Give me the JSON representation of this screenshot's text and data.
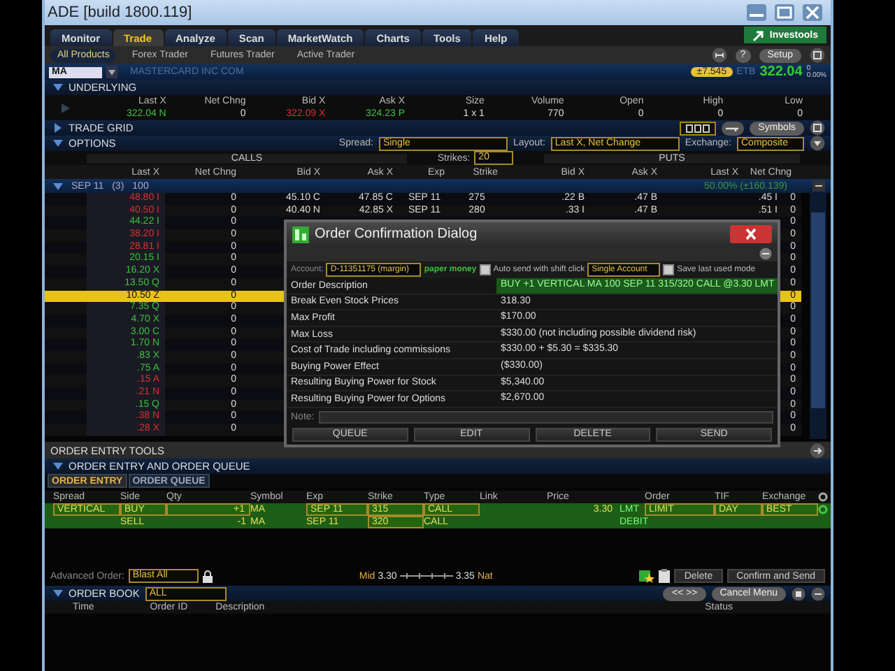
{
  "window": {
    "title": "ADE [build 1800.119]"
  },
  "main_tabs": [
    {
      "label": "Monitor",
      "selected": false
    },
    {
      "label": "Trade",
      "selected": true
    },
    {
      "label": "Analyze",
      "selected": false
    },
    {
      "label": "Scan",
      "selected": false
    },
    {
      "label": "MarketWatch",
      "selected": false
    },
    {
      "label": "Charts",
      "selected": false
    },
    {
      "label": "Tools",
      "selected": false
    },
    {
      "label": "Help",
      "selected": false
    }
  ],
  "investools_button": "Investools",
  "sub_tabs": [
    {
      "label": "All Products",
      "selected": true
    },
    {
      "label": "Forex Trader",
      "selected": false
    },
    {
      "label": "Futures Trader",
      "selected": false
    },
    {
      "label": "Active Trader",
      "selected": false
    }
  ],
  "help_button": "?",
  "setup_button": "Setup",
  "symbol_bar": {
    "symbol": "MA",
    "company": "MASTERCARD INC COM",
    "badge": "±7.545",
    "etb": "ETB",
    "last": "322.04",
    "change": "0",
    "percent": "0.00%"
  },
  "underlying": {
    "title": "UNDERLYING",
    "expanded": true,
    "columns": [
      "Last X",
      "Net Chng",
      "Bid X",
      "Ask X",
      "Size",
      "Volume",
      "Open",
      "High",
      "Low"
    ],
    "values": [
      {
        "text": "322.04 N",
        "color": "#3bc43b"
      },
      {
        "text": "0",
        "color": "#dddddd"
      },
      {
        "text": "322.09 X",
        "color": "#d83232"
      },
      {
        "text": "324.23 P",
        "color": "#3bc43b"
      },
      {
        "text": "1 x 1",
        "color": "#dddddd"
      },
      {
        "text": "770",
        "color": "#dddddd"
      },
      {
        "text": "0",
        "color": "#dddddd"
      },
      {
        "text": "0",
        "color": "#dddddd"
      },
      {
        "text": "0",
        "color": "#dddddd"
      }
    ]
  },
  "trade_grid": {
    "title": "TRADE GRID",
    "expanded": false,
    "symbols_button": "Symbols"
  },
  "options": {
    "title": "OPTIONS",
    "expanded": true,
    "spread_label": "Spread:",
    "spread": "Single",
    "layout_label": "Layout:",
    "layout": "Last X, Net Change",
    "exchange_label": "Exchange:",
    "exchange": "Composite",
    "calls_label": "CALLS",
    "puts_label": "PUTS",
    "strikes_label": "Strikes:",
    "strikes": "20",
    "columns": [
      "Last X",
      "Net Chng",
      "Bid X",
      "Ask X",
      "Exp",
      "Strike",
      "Bid X",
      "Ask X",
      "Last X",
      "Net Chng"
    ],
    "group": {
      "expiry": "SEP 11",
      "count": "(3)",
      "multiplier": "100",
      "expanded": true,
      "implied": "50.00% (±160.139)"
    },
    "rows": [
      {
        "selected": false,
        "color": "#d83232",
        "last": "48.80 I",
        "net": "0",
        "bid": "45.10 C",
        "ask": "47.85 C",
        "exp": "SEP 11",
        "strike": "275",
        "put_bid": ".22 B",
        "put_ask": ".47 B",
        "put_last": ".45 I",
        "put_net": "0"
      },
      {
        "selected": false,
        "color": "#d83232",
        "last": "40.50 I",
        "net": "0",
        "bid": "40.40 N",
        "ask": "42.85 X",
        "exp": "SEP 11",
        "strike": "280",
        "put_bid": ".33 I",
        "put_ask": ".47 B",
        "put_last": ".51 I",
        "put_net": "0"
      },
      {
        "selected": false,
        "color": "#3bc43b",
        "last": "44.22 I",
        "net": "0",
        "put_net": "0"
      },
      {
        "selected": false,
        "color": "#d83232",
        "last": "38.20 I",
        "net": "0",
        "put_net": "0"
      },
      {
        "selected": false,
        "color": "#d83232",
        "last": "28.81 I",
        "net": "0",
        "put_net": "0"
      },
      {
        "selected": false,
        "color": "#3bc43b",
        "last": "20.15 I",
        "net": "0",
        "put_net": "0"
      },
      {
        "selected": false,
        "color": "#3bc43b",
        "last": "16.20 X",
        "net": "0",
        "put_net": "0"
      },
      {
        "selected": false,
        "color": "#3bc43b",
        "last": "13.50 Q",
        "net": "0",
        "put_net": "0"
      },
      {
        "selected": true,
        "last": "10.50 Z",
        "net": "0",
        "put_net": "0"
      },
      {
        "selected": false,
        "color": "#3bc43b",
        "last": "7.35 Q",
        "net": "0",
        "put_net": "0"
      },
      {
        "selected": false,
        "color": "#3bc43b",
        "last": "4.70 X",
        "net": "0",
        "put_net": "0"
      },
      {
        "selected": false,
        "color": "#3bc43b",
        "last": "3.00 C",
        "net": "0",
        "put_net": "0"
      },
      {
        "selected": false,
        "color": "#3bc43b",
        "last": "1.70 N",
        "net": "0",
        "put_net": "0"
      },
      {
        "selected": false,
        "color": "#3bc43b",
        "last": ".83 X",
        "net": "0",
        "put_net": "0"
      },
      {
        "selected": false,
        "color": "#3bc43b",
        "last": ".75 A",
        "net": "0",
        "put_net": "0"
      },
      {
        "selected": false,
        "color": "#d83232",
        "last": ".15 A",
        "net": "0",
        "put_net": "0"
      },
      {
        "selected": false,
        "color": "#d83232",
        "last": ".21 N",
        "net": "0",
        "put_net": "0"
      },
      {
        "selected": false,
        "color": "#3bc43b",
        "last": ".15 Q",
        "net": "0",
        "put_net": "0"
      },
      {
        "selected": false,
        "color": "#d83232",
        "last": ".38 N",
        "net": "0",
        "put_net": "0"
      },
      {
        "selected": false,
        "color": "#d83232",
        "last": ".28 X",
        "net": "0",
        "put_net": "0"
      }
    ]
  },
  "order_confirmation": {
    "title": "Order Confirmation Dialog",
    "account_label": "Account:",
    "account": "D-11351175 (margin)",
    "paper_money": "paper money",
    "auto_send": {
      "label": "Auto send with shift click",
      "checked": false
    },
    "mode": "Single Account",
    "save_mode": {
      "label": "Save last used mode",
      "checked": false
    },
    "details": [
      {
        "label": "Order Description",
        "value": "BUY +1 VERTICAL MA 100 SEP 11 315/320 CALL @3.30 LMT",
        "highlighted": true
      },
      {
        "label": "Break Even Stock Prices",
        "value": "318.30",
        "highlighted": false
      },
      {
        "label": "Max Profit",
        "value": "$170.00",
        "highlighted": false
      },
      {
        "label": "Max Loss",
        "value": "$330.00 (not including possible dividend risk)",
        "highlighted": false
      },
      {
        "label": "Cost of Trade including commissions",
        "value": "$330.00 + $5.30 = $335.30",
        "highlighted": false
      },
      {
        "label": "Buying Power Effect",
        "value": "($330.00)",
        "highlighted": false
      },
      {
        "label": "Resulting Buying Power for Stock",
        "value": "$5,340.00",
        "highlighted": false
      },
      {
        "label": "Resulting Buying Power for Options",
        "value": "$2,670.00",
        "highlighted": false
      }
    ],
    "note_label": "Note:",
    "buttons": [
      "QUEUE",
      "EDIT",
      "DELETE",
      "SEND"
    ]
  },
  "order_entry_tools": {
    "title": "ORDER ENTRY TOOLS",
    "section": "ORDER ENTRY AND ORDER QUEUE",
    "tabs": [
      {
        "label": "ORDER ENTRY",
        "selected": true
      },
      {
        "label": "ORDER QUEUE",
        "selected": false
      }
    ],
    "columns": [
      "Spread",
      "Side",
      "Qty",
      "Symbol",
      "Exp",
      "Strike",
      "Type",
      "Link",
      "Price",
      "Order",
      "TIF",
      "Exchange"
    ],
    "legs": [
      {
        "spread": "VERTICAL",
        "side": "BUY",
        "qty": "+1",
        "symbol": "MA",
        "exp": "SEP 11",
        "strike": "315",
        "type": "CALL",
        "price": "3.30",
        "price_type": "LMT",
        "order": "LIMIT",
        "tif": "DAY",
        "exchange": "BEST"
      },
      {
        "side": "SELL",
        "qty": "-1",
        "symbol": "MA",
        "exp": "SEP 11",
        "strike": "320",
        "type": "CALL",
        "price_type": "DEBIT"
      }
    ],
    "advanced_label": "Advanced Order:",
    "advanced": "Blast All",
    "mid_label": "Mid",
    "mid": "3.30",
    "nat": "3.35",
    "nat_label": "Nat",
    "delete_button": "Delete",
    "confirm_button": "Confirm and Send"
  },
  "order_book": {
    "title": "ORDER BOOK",
    "expanded": true,
    "filter": "ALL",
    "nav_button": "<< >>",
    "cancel_menu_button": "Cancel Menu",
    "columns": [
      "Time",
      "Order ID",
      "Description",
      "Status"
    ]
  }
}
